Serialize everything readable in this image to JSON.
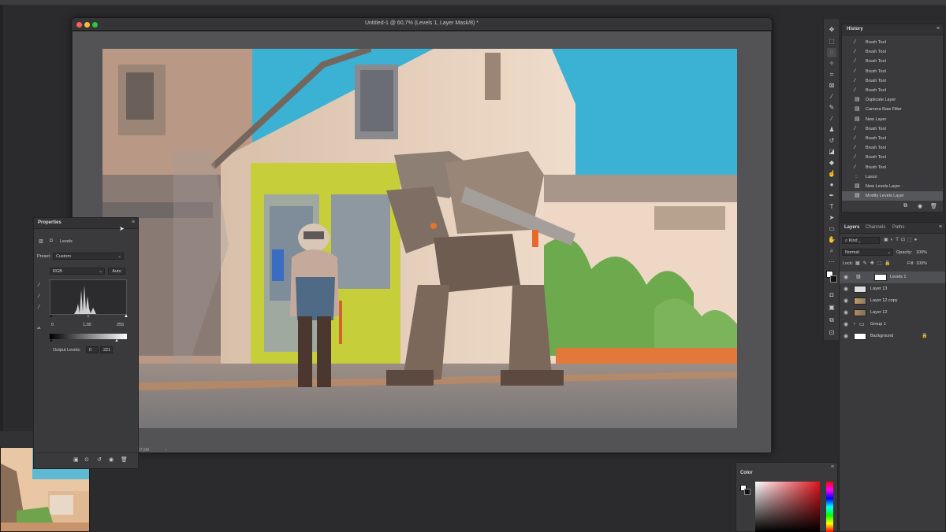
{
  "document": {
    "title": "Untitled-1 @ 60,7% (Levels 1, Layer Mask/8) *",
    "status": "07,5M",
    "status_arrow": "›"
  },
  "history": {
    "tab": "History",
    "items": [
      {
        "label": "Brush Tool",
        "icon": "brush-icon"
      },
      {
        "label": "Brush Tool",
        "icon": "brush-icon"
      },
      {
        "label": "Brush Tool",
        "icon": "brush-icon"
      },
      {
        "label": "Brush Tool",
        "icon": "brush-icon"
      },
      {
        "label": "Brush Tool",
        "icon": "brush-icon"
      },
      {
        "label": "Brush Tool",
        "icon": "brush-icon"
      },
      {
        "label": "Duplicate Layer",
        "icon": "layer-icon"
      },
      {
        "label": "Camera Raw Filter",
        "icon": "layer-icon"
      },
      {
        "label": "New Layer",
        "icon": "layer-icon"
      },
      {
        "label": "Brush Tool",
        "icon": "brush-icon"
      },
      {
        "label": "Brush Tool",
        "icon": "brush-icon"
      },
      {
        "label": "Brush Tool",
        "icon": "brush-icon"
      },
      {
        "label": "Brush Tool",
        "icon": "brush-icon"
      },
      {
        "label": "Brush Tool",
        "icon": "brush-icon"
      },
      {
        "label": "Lasso",
        "icon": "lasso-icon"
      },
      {
        "label": "New Levels Layer",
        "icon": "layer-icon"
      },
      {
        "label": "Modify Levels Layer",
        "icon": "layer-icon",
        "selected": true
      }
    ]
  },
  "layers": {
    "tabs": [
      "Layers",
      "Channels",
      "Paths"
    ],
    "kind_label": "Kind",
    "blend_mode": "Normal",
    "opacity_label": "Opacity:",
    "opacity_value": "100%",
    "lock_label": "Lock:",
    "fill_label": "Fill:",
    "fill_value": "100%",
    "items": [
      {
        "name": "Levels 1",
        "selected": true
      },
      {
        "name": "Layer 13"
      },
      {
        "name": "Layer 12 copy"
      },
      {
        "name": "Layer 12"
      },
      {
        "name": "Group 1"
      },
      {
        "name": "Background"
      }
    ]
  },
  "properties": {
    "tab": "Properties",
    "adjustment_name": "Levels",
    "preset_label": "Preset:",
    "preset_value": "Custom",
    "channel_value": "RGB",
    "auto_label": "Auto",
    "input_black": "0",
    "input_gamma": "1,00",
    "input_white": "255",
    "output_label": "Output Levels:",
    "output_black": "0",
    "output_white": "221"
  },
  "color_panel": {
    "tab": "Color"
  },
  "colors": {
    "sky": "#39b2d4",
    "accent_orange": "#e07a3a",
    "door_yellow": "#c8d235"
  }
}
